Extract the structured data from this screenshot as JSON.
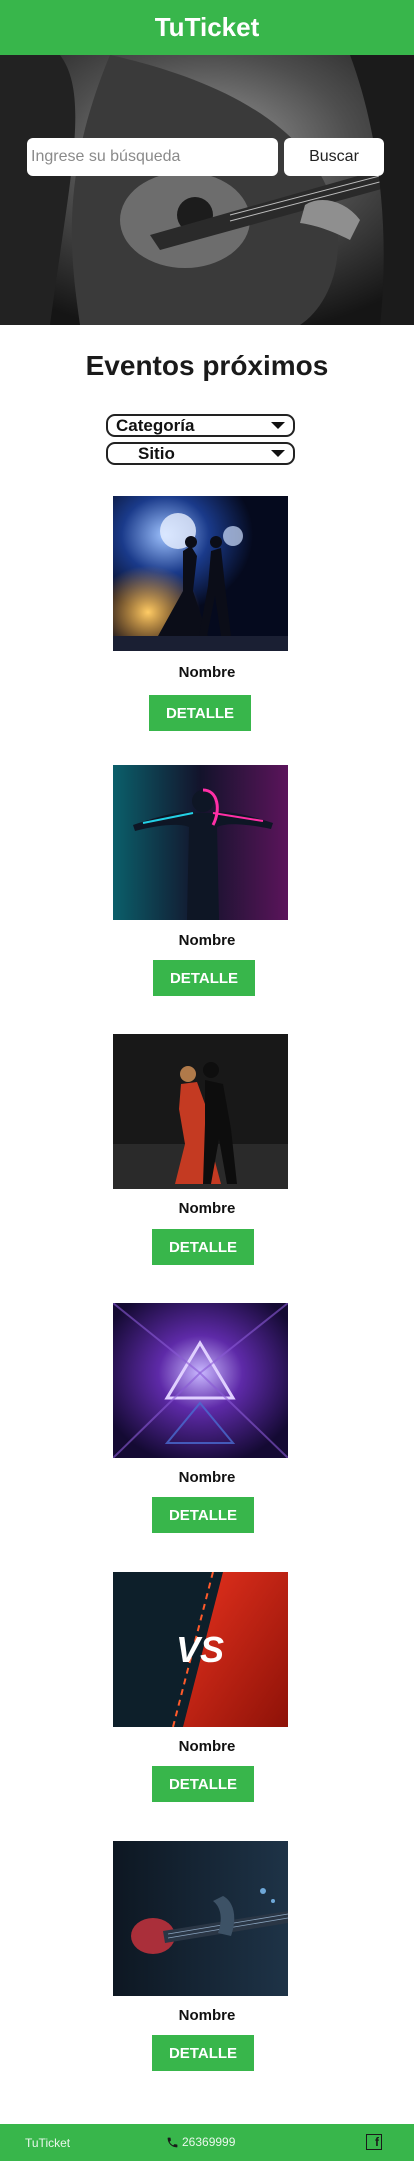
{
  "header": {
    "title": "TuTicket"
  },
  "search": {
    "placeholder": "Ingrese su búsqueda",
    "button_label": "Buscar"
  },
  "events_section": {
    "title": "Eventos próximos"
  },
  "filters": {
    "category_label": "Categoría",
    "site_label": "Sitio"
  },
  "events": [
    {
      "name": "Nombre",
      "button_label": "DETALLE"
    },
    {
      "name": "Nombre",
      "button_label": "DETALLE"
    },
    {
      "name": "Nombre",
      "button_label": "DETALLE"
    },
    {
      "name": "Nombre",
      "button_label": "DETALLE"
    },
    {
      "name": "Nombre",
      "button_label": "DETALLE"
    },
    {
      "name": "Nombre",
      "button_label": "DETALLE"
    }
  ],
  "versus_text": "VS",
  "footer": {
    "brand": "TuTicket",
    "phone": "26369999",
    "facebook_glyph": "f"
  },
  "colors": {
    "brand_green": "#38b64b"
  }
}
